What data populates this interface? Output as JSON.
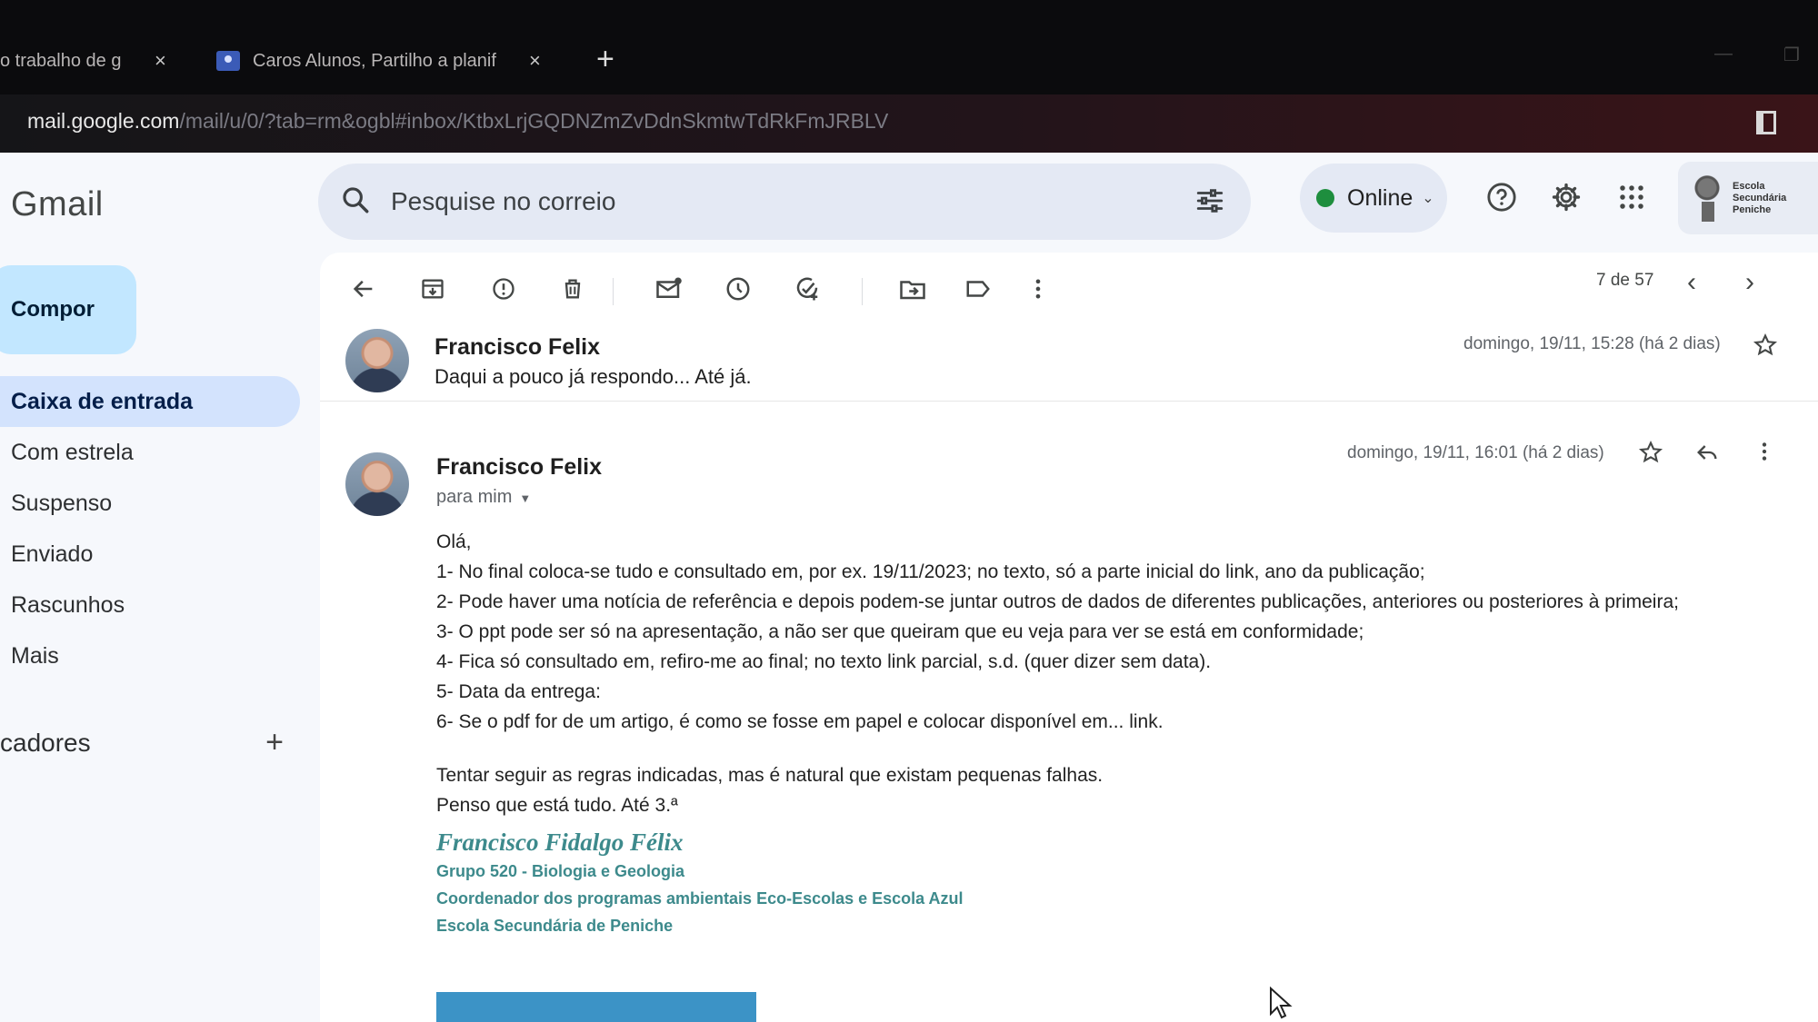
{
  "browser": {
    "tabs": [
      {
        "title": "o trabalho de g",
        "active": false
      },
      {
        "title": "Caros Alunos,  Partilho a planif",
        "active": true
      }
    ],
    "tab_close": "×",
    "new_tab": "+",
    "url_host": "mail.google.com",
    "url_path": "/mail/u/0/?tab=rm&ogbl#inbox/KtbxLrjGQDNZmZvDdnSkmtwTdRkFmJRBLV"
  },
  "header": {
    "logo": "Gmail",
    "search_placeholder": "Pesquise no correio",
    "status_label": "Online",
    "status_color": "#1e8e3e",
    "account_name": "Escola Secundária Peniche"
  },
  "sidebar": {
    "compose_label": "Compor",
    "items": [
      {
        "label": "Caixa de entrada",
        "active": true
      },
      {
        "label": "Com estrela",
        "active": false
      },
      {
        "label": "Suspenso",
        "active": false
      },
      {
        "label": "Enviado",
        "active": false
      },
      {
        "label": "Rascunhos",
        "active": false
      },
      {
        "label": "Mais",
        "active": false
      }
    ],
    "labels_title": "cadores",
    "labels_add": "+"
  },
  "toolbar": {
    "icons": [
      "back-arrow-icon",
      "archive-icon",
      "report-spam-icon",
      "delete-icon",
      "mark-unread-icon",
      "snooze-icon",
      "add-task-icon",
      "move-to-icon",
      "label-icon",
      "more-vert-icon"
    ],
    "pager_text": "7 de 57"
  },
  "thread": {
    "message1": {
      "sender": "Francisco Felix",
      "snippet": "Daqui a pouco já respondo... Até já.",
      "date": "domingo, 19/11, 15:28 (há 2 dias)"
    },
    "message2": {
      "sender": "Francisco Felix",
      "recipient": "para mim",
      "date": "domingo, 19/11, 16:01 (há 2 dias)",
      "body": {
        "greeting": "Olá,",
        "points": [
          "1- No final coloca-se tudo e consultado em, por ex. 19/11/2023; no texto, só a parte inicial do link, ano da publicação;",
          "2- Pode haver uma notícia de referência e depois podem-se juntar outros de dados de diferentes publicações, anteriores ou posteriores à primeira;",
          "3- O ppt pode ser só na apresentação, a não ser que queiram que eu veja para ver se está em conformidade;",
          "4- Fica só consultado em, refiro-me ao final; no texto link parcial, s.d. (quer dizer sem  data).",
          "5- Data da entrega:",
          "6- Se o pdf for de um artigo, é como se fosse em papel e colocar disponível em... link."
        ],
        "closing1": "Tentar seguir as regras indicadas, mas é natural que existam pequenas falhas.",
        "closing2": "Penso que está tudo. Até 3.ª"
      },
      "signature": {
        "name": "Francisco Fidalgo Félix",
        "line1": "Grupo 520 - Biologia e Geologia",
        "line2": "Coordenador dos programas ambientais Eco-Escolas e Escola Azul",
        "line3": "Escola Secundária de Peniche"
      }
    }
  }
}
